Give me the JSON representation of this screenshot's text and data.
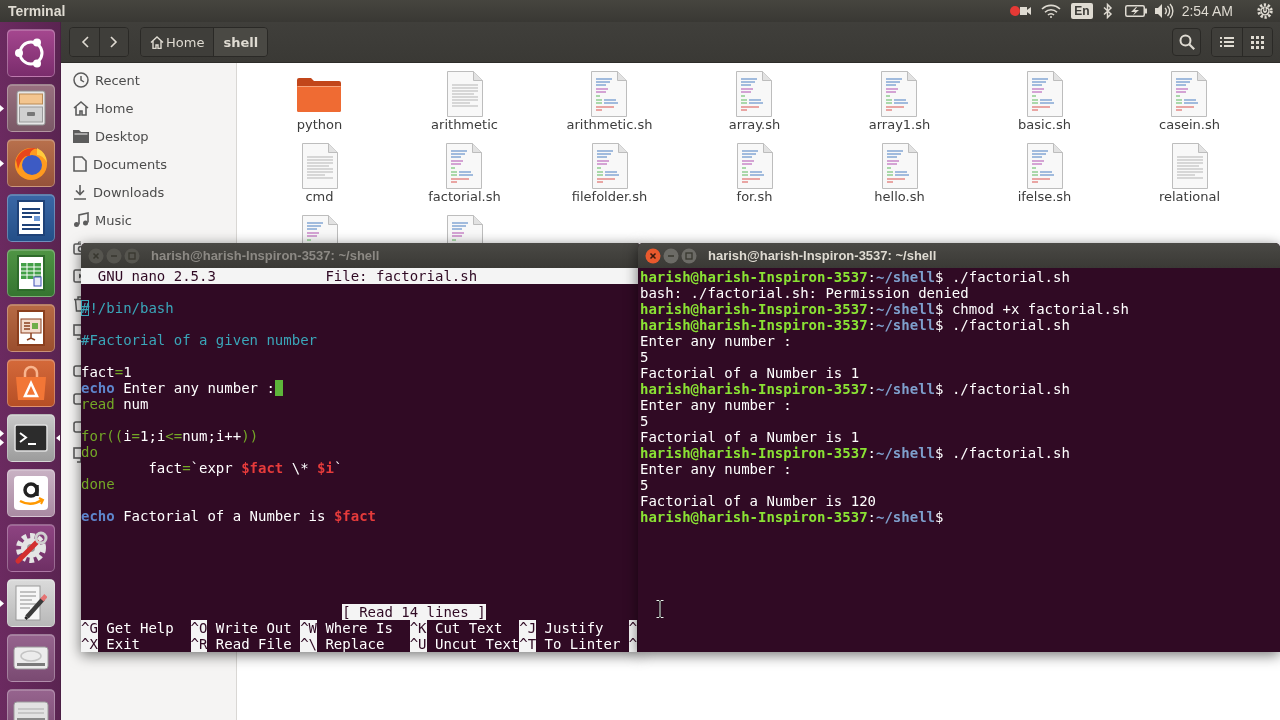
{
  "top_panel": {
    "app_title": "Terminal",
    "keyboard_layout": "En",
    "clock": "2:54 AM"
  },
  "launcher": [
    {
      "running": false,
      "focused": false,
      "two_windows": false
    },
    {
      "running": true,
      "focused": false,
      "two_windows": false
    },
    {
      "running": true,
      "focused": false,
      "two_windows": false
    },
    {
      "running": false,
      "focused": false,
      "two_windows": false
    },
    {
      "running": false,
      "focused": false,
      "two_windows": false
    },
    {
      "running": false,
      "focused": false,
      "two_windows": false
    },
    {
      "running": false,
      "focused": false,
      "two_windows": false
    },
    {
      "running": true,
      "focused": true,
      "two_windows": true
    },
    {
      "running": false,
      "focused": false,
      "two_windows": false
    },
    {
      "running": false,
      "focused": false,
      "two_windows": false
    },
    {
      "running": true,
      "focused": false,
      "two_windows": false
    },
    {
      "running": false,
      "focused": false,
      "two_windows": false
    },
    {
      "running": false,
      "focused": false,
      "two_windows": false
    }
  ],
  "file_manager": {
    "breadcrumb": [
      {
        "label": "Home",
        "kind": "home",
        "selected": false
      },
      {
        "label": "shell",
        "kind": "folder",
        "selected": true
      }
    ],
    "sidebar": [
      {
        "label": "Recent"
      },
      {
        "label": "Home"
      },
      {
        "label": "Desktop"
      },
      {
        "label": "Documents"
      },
      {
        "label": "Downloads"
      },
      {
        "label": "Music"
      }
    ],
    "files": [
      {
        "label": "python",
        "kind": "folder"
      },
      {
        "label": "arithmetic",
        "kind": "text"
      },
      {
        "label": "arithmetic.sh",
        "kind": "script"
      },
      {
        "label": "array.sh",
        "kind": "script"
      },
      {
        "label": "array1.sh",
        "kind": "script"
      },
      {
        "label": "basic.sh",
        "kind": "script"
      },
      {
        "label": "casein.sh",
        "kind": "script"
      },
      {
        "label": "cmd",
        "kind": "text"
      },
      {
        "label": "factorial.sh",
        "kind": "script"
      },
      {
        "label": "filefolder.sh",
        "kind": "script"
      },
      {
        "label": "for.sh",
        "kind": "script"
      },
      {
        "label": "hello.sh",
        "kind": "script"
      },
      {
        "label": "ifelse.sh",
        "kind": "script"
      },
      {
        "label": "relational",
        "kind": "text"
      },
      {
        "kind": "script"
      },
      {
        "kind": "script"
      }
    ]
  },
  "nano_window": {
    "title": "harish@harish-Inspiron-3537: ~/shell",
    "focused": false,
    "header": {
      "version": "GNU nano 2.5.3",
      "file": "File: factorial.sh"
    },
    "lines": [
      {
        "kind": "code",
        "segments": [
          {
            "text": "#",
            "kind": "cursor"
          },
          {
            "text": "!/bin/bash",
            "kind": "comment"
          }
        ]
      },
      {
        "kind": "blank"
      },
      {
        "kind": "code",
        "segments": [
          {
            "text": "#Factorial of a given number",
            "kind": "comment"
          }
        ]
      },
      {
        "kind": "blank"
      },
      {
        "kind": "code",
        "segments": [
          {
            "text": "fact",
            "kind": "plain"
          },
          {
            "text": "=",
            "kind": "keyword"
          },
          {
            "text": "1",
            "kind": "plain"
          }
        ]
      },
      {
        "kind": "code",
        "segments": [
          {
            "text": "echo",
            "kind": "builtin"
          },
          {
            "text": " Enter any number :",
            "kind": "plain"
          },
          {
            "kind": "trailing_space"
          }
        ]
      },
      {
        "kind": "code",
        "segments": [
          {
            "text": "read",
            "kind": "keyword"
          },
          {
            "text": " num",
            "kind": "plain"
          }
        ]
      },
      {
        "kind": "blank"
      },
      {
        "kind": "code",
        "segments": [
          {
            "text": "for((",
            "kind": "keyword"
          },
          {
            "text": "i",
            "kind": "plain"
          },
          {
            "text": "=",
            "kind": "keyword"
          },
          {
            "text": "1;i",
            "kind": "plain"
          },
          {
            "text": "<=",
            "kind": "keyword"
          },
          {
            "text": "num;i++",
            "kind": "plain"
          },
          {
            "text": "))",
            "kind": "keyword"
          }
        ]
      },
      {
        "kind": "code",
        "segments": [
          {
            "text": "do",
            "kind": "keyword"
          }
        ]
      },
      {
        "kind": "code",
        "segments": [
          {
            "kind": "tab"
          },
          {
            "text": "fact",
            "kind": "plain"
          },
          {
            "text": "=",
            "kind": "keyword"
          },
          {
            "text": "`expr ",
            "kind": "plain"
          },
          {
            "text": "$fact",
            "kind": "variable"
          },
          {
            "text": " \\* ",
            "kind": "plain"
          },
          {
            "text": "$i",
            "kind": "variable"
          },
          {
            "text": "`",
            "kind": "plain"
          }
        ]
      },
      {
        "kind": "code",
        "segments": [
          {
            "text": "done",
            "kind": "keyword"
          }
        ]
      },
      {
        "kind": "blank"
      },
      {
        "kind": "code",
        "segments": [
          {
            "text": "echo",
            "kind": "builtin"
          },
          {
            "text": " Factorial of a Number is ",
            "kind": "plain"
          },
          {
            "text": "$fact",
            "kind": "variable"
          }
        ]
      }
    ],
    "status": "[ Read 14 lines ]",
    "shortcuts": [
      [
        {
          "key": "^G",
          "label": "Get Help"
        },
        {
          "key": "^O",
          "label": "Write Out"
        },
        {
          "key": "^W",
          "label": "Where Is"
        },
        {
          "key": "^K",
          "label": "Cut Text"
        },
        {
          "key": "^J",
          "label": "Justify"
        },
        {
          "key": "^"
        }
      ],
      [
        {
          "key": "^X",
          "label": "Exit"
        },
        {
          "key": "^R",
          "label": "Read File"
        },
        {
          "key": "^\\",
          "label": "Replace"
        },
        {
          "key": "^U",
          "label": "Uncut Text"
        },
        {
          "key": "^T",
          "label": "To Linter"
        },
        {
          "key": "^"
        }
      ]
    ]
  },
  "shell_window": {
    "title": "harish@harish-Inspiron-3537: ~/shell",
    "focused": true,
    "lines": [
      {
        "kind": "prompt",
        "segments": [
          {
            "text": "harish@harish-Inspiron-3537",
            "kind": "user"
          },
          {
            "text": ":",
            "kind": "plain"
          },
          {
            "text": "~/shell",
            "kind": "path"
          },
          {
            "text": "$ ./factorial.sh",
            "kind": "plain"
          }
        ]
      },
      {
        "kind": "output",
        "text": "bash: ./factorial.sh: Permission denied"
      },
      {
        "kind": "prompt",
        "segments": [
          {
            "text": "harish@harish-Inspiron-3537",
            "kind": "user"
          },
          {
            "text": ":",
            "kind": "plain"
          },
          {
            "text": "~/shell",
            "kind": "path"
          },
          {
            "text": "$ chmod +x factorial.sh",
            "kind": "plain"
          }
        ]
      },
      {
        "kind": "prompt",
        "segments": [
          {
            "text": "harish@harish-Inspiron-3537",
            "kind": "user"
          },
          {
            "text": ":",
            "kind": "plain"
          },
          {
            "text": "~/shell",
            "kind": "path"
          },
          {
            "text": "$ ./factorial.sh",
            "kind": "plain"
          }
        ]
      },
      {
        "kind": "output",
        "text": "Enter any number :"
      },
      {
        "kind": "output",
        "text": "5"
      },
      {
        "kind": "output",
        "text": "Factorial of a Number is 1"
      },
      {
        "kind": "prompt",
        "segments": [
          {
            "text": "harish@harish-Inspiron-3537",
            "kind": "user"
          },
          {
            "text": ":",
            "kind": "plain"
          },
          {
            "text": "~/shell",
            "kind": "path"
          },
          {
            "text": "$ ./factorial.sh",
            "kind": "plain"
          }
        ]
      },
      {
        "kind": "output",
        "text": "Enter any number :"
      },
      {
        "kind": "output",
        "text": "5"
      },
      {
        "kind": "output",
        "text": "Factorial of a Number is 1"
      },
      {
        "kind": "prompt",
        "segments": [
          {
            "text": "harish@harish-Inspiron-3537",
            "kind": "user"
          },
          {
            "text": ":",
            "kind": "plain"
          },
          {
            "text": "~/shell",
            "kind": "path"
          },
          {
            "text": "$ ./factorial.sh",
            "kind": "plain"
          }
        ]
      },
      {
        "kind": "output",
        "text": "Enter any number :"
      },
      {
        "kind": "output",
        "text": "5"
      },
      {
        "kind": "output",
        "text": "Factorial of a Number is 120"
      },
      {
        "kind": "prompt",
        "segments": [
          {
            "text": "harish@harish-Inspiron-3537",
            "kind": "user"
          },
          {
            "text": ":",
            "kind": "plain"
          },
          {
            "text": "~/shell",
            "kind": "path"
          },
          {
            "text": "$",
            "kind": "plain"
          }
        ]
      }
    ]
  }
}
